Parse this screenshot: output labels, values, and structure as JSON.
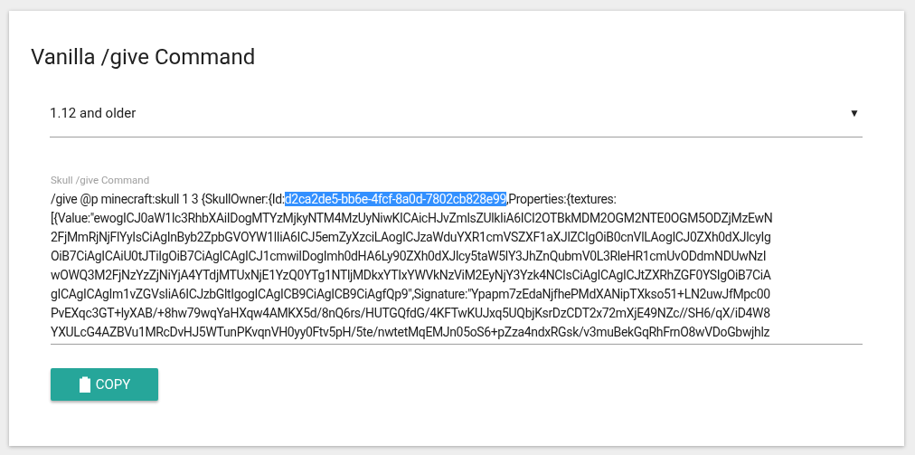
{
  "title": "Vanilla /give Command",
  "version_select": {
    "value": "1.12 and older",
    "arrow": "▼"
  },
  "command_field": {
    "label": "Skull /give Command",
    "lines": [
      [
        {
          "text": "/give @p minecraft:skull 1 3 {SkullOwner:{Id:",
          "selected": false
        },
        {
          "text": "d2ca2de5-bb6e-4fcf-8a0d-7802cb828e99",
          "selected": true
        },
        {
          "text": ",Properties:{textures:",
          "selected": false
        }
      ],
      [
        {
          "text": "[{Value:\"ewogICJ0aW1lc3RhbXAiIDogMTYzMjkyNTM4MzUyNiwKICAicHJvZmlsZUlkIiA6ICI2OTBkMDM2OGM2NTE0OGM5ODZjMzEwN",
          "selected": false
        }
      ],
      [
        {
          "text": "2FjMmRjNjFlYyIsCiAgInByb2ZpbGVOYW1lIiA6ICJ5emZyXzciLAogICJzaWduYXR1cmVSZXF1aXJlZCIgOiB0cnVlLAogICJ0ZXh0dXJlcyIg",
          "selected": false
        }
      ],
      [
        {
          "text": "OiB7CiAgICAiU0tJTiIgOiB7CiAgICAgICJ1cmwiIDogImh0dHA6Ly90ZXh0dXJlcy5taW5lY3JhZnQubmV0L3RleHR1cmUvODdmNDUwNzI",
          "selected": false
        }
      ],
      [
        {
          "text": "wOWQ3M2FjNzYzZjNiYjA4YTdjMTUxNjE1YzQ0YTg1NTljMDkxYTIxYWVkNzViM2EyNjY3Yzk4NCIsCiAgICAgICJtZXRhZGF0YSIgOiB7CiA",
          "selected": false
        }
      ],
      [
        {
          "text": "gICAgICAgIm1vZGVsIiA6ICJzbGltIgogICAgICB9CiAgICB9CiAgfQp9\",Signature:\"Ypapm7zEdaNjfhePMdXANipTXkso51+LN2uwJfMpc00",
          "selected": false
        }
      ],
      [
        {
          "text": "PvEXqc3GT+lyXAB/+8hw79wqYaHXqw4AMKX5d/8nQ6rs/HUTGQfdG/4KFTwKUJxq5UQbjKsrDzCDT2x72mXjE49NZc//SH6/qX/iD4W8",
          "selected": false
        }
      ],
      [
        {
          "text": "YXULcG4AZBVu1MRcDvHJ5WTunPKvqnVH0yy0Ftv5pH/5te/nwtetMqEMJn05oS6+pZza4ndxRGsk/v3muBekGqRhFrnO8wVDoGbwjhlz",
          "selected": false
        }
      ]
    ]
  },
  "copy_button": {
    "label": "COPY"
  }
}
